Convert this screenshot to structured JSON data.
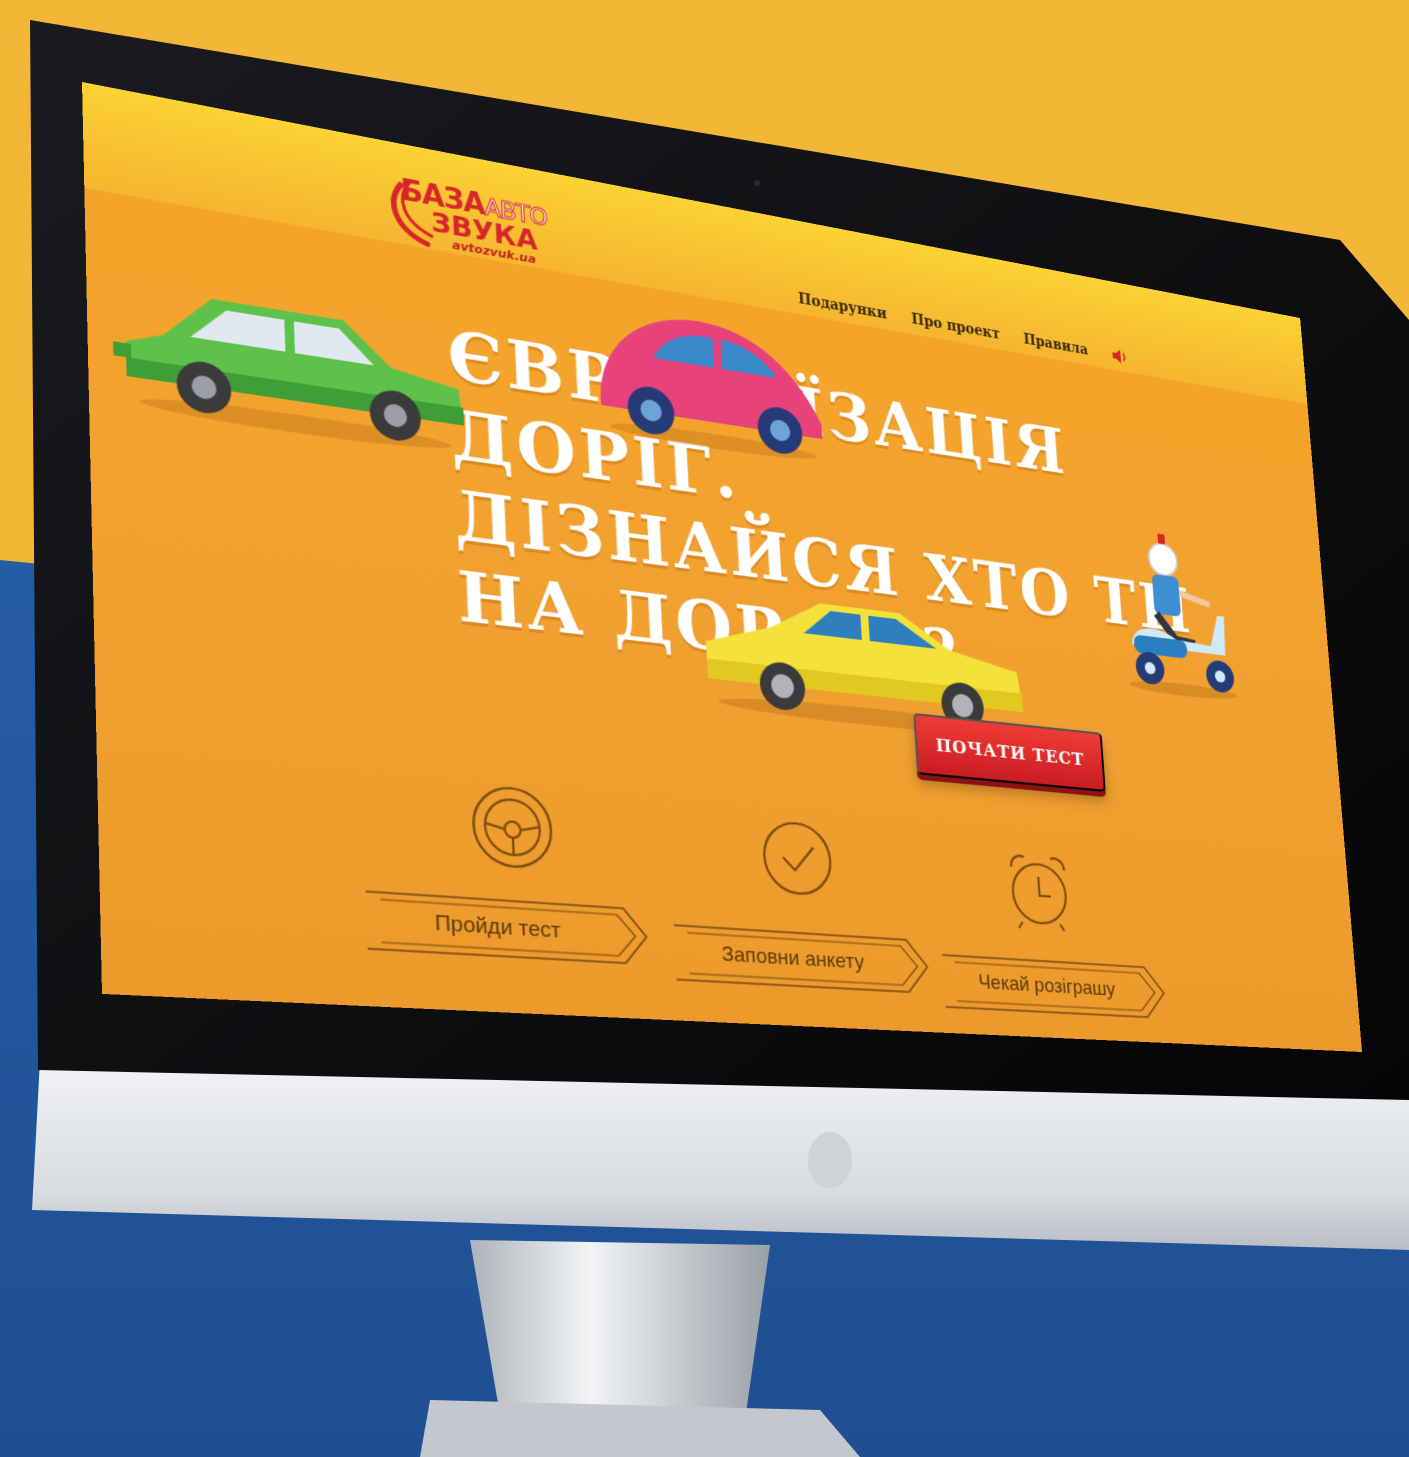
{
  "site": {
    "logo": {
      "line1_a": "БАЗА",
      "line1_b": "АВТО",
      "line2": "ЗВУКА",
      "domain": "avtozvuk.ua"
    },
    "nav": [
      {
        "label": "Подарунки"
      },
      {
        "label": "Про проект"
      },
      {
        "label": "Правила"
      }
    ],
    "headline": [
      "ЄВРОПЕЇЗАЦІЯ",
      "ДОРІГ.",
      "ДІЗНАЙСЯ ХТО ТИ",
      "НА ДОРОЗІ?"
    ],
    "cta_label": "ПОЧАТИ ТЕСТ",
    "steps": [
      {
        "label": "Пройди тест",
        "icon": "steering-wheel-icon"
      },
      {
        "label": "Заповни анкету",
        "icon": "checkmark-circle-icon"
      },
      {
        "label": "Чекай розіграшу",
        "icon": "alarm-clock-icon"
      }
    ]
  },
  "colors": {
    "background_top": "#f4b637",
    "background_bottom": "#2358a0",
    "site_orange": "#f0a031",
    "accent_red": "#d6262a",
    "monitor_bezel": "#0c0c0e",
    "monitor_chin": "#dfe2e6"
  }
}
